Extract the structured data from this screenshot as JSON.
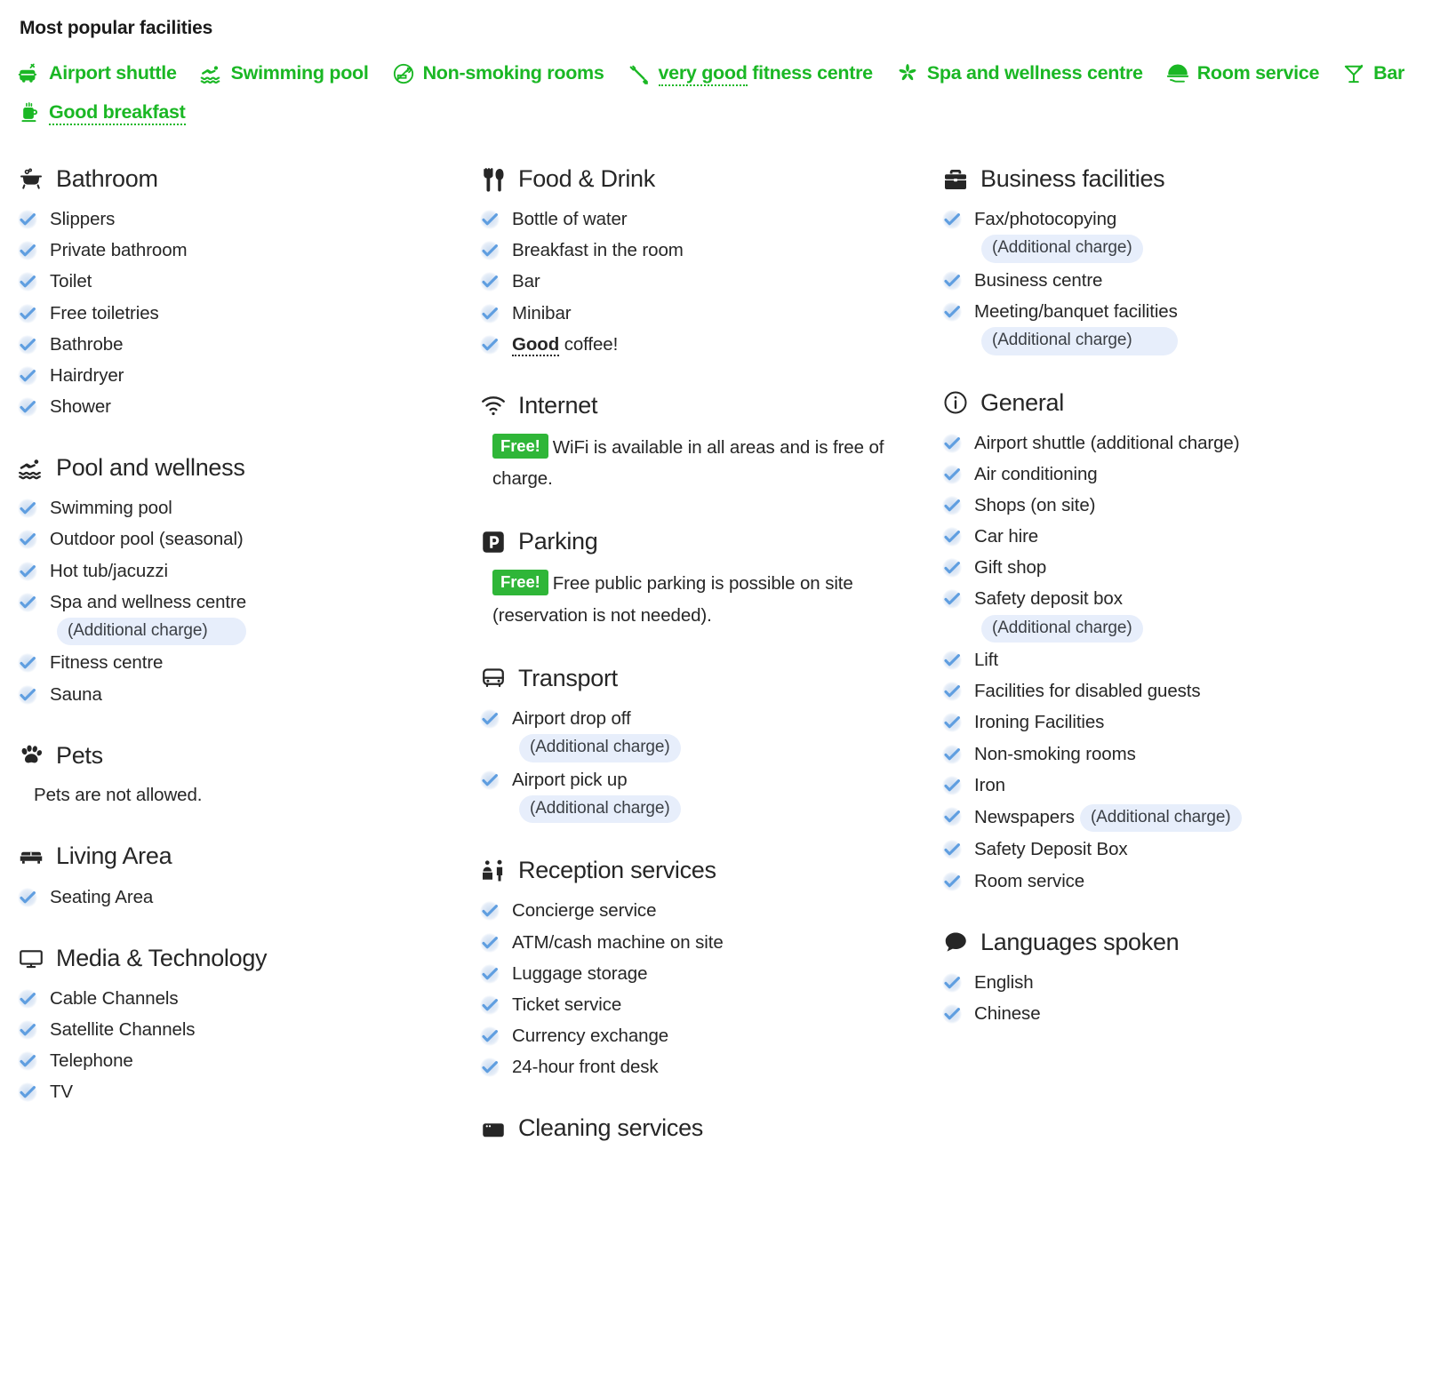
{
  "popular": {
    "title": "Most popular facilities",
    "items": [
      {
        "label": "Airport shuttle",
        "icon": "airport-shuttle-icon",
        "dotted": false
      },
      {
        "label": "Swimming pool",
        "icon": "swimming-pool-icon",
        "dotted": false
      },
      {
        "label": "Non-smoking rooms",
        "icon": "non-smoking-icon",
        "dotted": false
      },
      {
        "label": "very good fitness centre",
        "icon": "fitness-icon",
        "dotted": true,
        "dotted_part": "very good"
      },
      {
        "label": "Spa and wellness centre",
        "icon": "spa-icon",
        "dotted": false
      },
      {
        "label": "Room service",
        "icon": "room-service-icon",
        "dotted": false
      },
      {
        "label": "Bar",
        "icon": "bar-icon",
        "dotted": false
      },
      {
        "label": "Good breakfast",
        "icon": "breakfast-icon",
        "dotted": true,
        "dotted_part": "Good breakfast"
      }
    ]
  },
  "accent_green": "#1ab724",
  "free_badge_color": "#2fb638",
  "tick_color": "#5f9ee0",
  "charge_badge_bg": "#e7eefb",
  "columns": [
    {
      "groups": [
        {
          "title": "Bathroom",
          "icon": "bathtub-icon",
          "items": [
            {
              "label": "Slippers"
            },
            {
              "label": "Private bathroom"
            },
            {
              "label": "Toilet"
            },
            {
              "label": "Free toiletries"
            },
            {
              "label": "Bathrobe"
            },
            {
              "label": "Hairdryer"
            },
            {
              "label": "Shower"
            }
          ]
        },
        {
          "title": "Pool and wellness",
          "icon": "swimmer-icon",
          "items": [
            {
              "label": "Swimming pool"
            },
            {
              "label": "Outdoor pool (seasonal)"
            },
            {
              "label": "Hot tub/jacuzzi"
            },
            {
              "label": "Spa and wellness centre",
              "charge": "(Additional charge)",
              "charge_position": "block"
            },
            {
              "label": "Fitness centre"
            },
            {
              "label": "Sauna"
            }
          ]
        },
        {
          "title": "Pets",
          "icon": "paw-icon",
          "note": "Pets are not allowed.",
          "items": []
        },
        {
          "title": "Living Area",
          "icon": "sofa-icon",
          "items": [
            {
              "label": "Seating Area"
            }
          ]
        },
        {
          "title": "Media & Technology",
          "icon": "tv-icon",
          "items": [
            {
              "label": "Cable Channels"
            },
            {
              "label": "Satellite Channels"
            },
            {
              "label": "Telephone"
            },
            {
              "label": "TV"
            }
          ]
        }
      ]
    },
    {
      "groups": [
        {
          "title": "Food & Drink",
          "icon": "cutlery-icon",
          "items": [
            {
              "label": "Bottle of water"
            },
            {
              "label": "Breakfast in the room"
            },
            {
              "label": "Bar"
            },
            {
              "label": "Minibar"
            },
            {
              "label": "Good coffee!",
              "emphasis": "Good",
              "emphasis_rest": " coffee!"
            }
          ]
        },
        {
          "title": "Internet",
          "icon": "wifi-icon",
          "badge": "Free!",
          "paragraph": "WiFi is available in all areas and is free of charge.",
          "items": []
        },
        {
          "title": "Parking",
          "icon": "parking-icon",
          "badge": "Free!",
          "paragraph": "Free public parking is possible on site (reservation is not needed).",
          "items": []
        },
        {
          "title": "Transport",
          "icon": "bus-icon",
          "items": [
            {
              "label": "Airport drop off",
              "charge": "(Additional charge)",
              "charge_position": "block"
            },
            {
              "label": "Airport pick up",
              "charge": "(Additional charge)",
              "charge_position": "block"
            }
          ]
        },
        {
          "title": "Reception services",
          "icon": "reception-icon",
          "items": [
            {
              "label": "Concierge service"
            },
            {
              "label": "ATM/cash machine on site"
            },
            {
              "label": "Luggage storage"
            },
            {
              "label": "Ticket service"
            },
            {
              "label": "Currency exchange"
            },
            {
              "label": "24-hour front desk"
            }
          ]
        },
        {
          "title": "Cleaning services",
          "icon": "cleaning-icon",
          "cut_off": true,
          "items": []
        }
      ]
    },
    {
      "groups": [
        {
          "title": "Business facilities",
          "icon": "briefcase-icon",
          "items": [
            {
              "label": "Fax/photocopying",
              "charge": "(Additional charge)",
              "charge_position": "block"
            },
            {
              "label": "Business centre"
            },
            {
              "label": "Meeting/banquet facilities",
              "charge": "(Additional charge)",
              "charge_position": "block"
            }
          ]
        },
        {
          "title": "General",
          "icon": "info-icon",
          "items": [
            {
              "label": "Airport shuttle (additional charge)"
            },
            {
              "label": "Air conditioning"
            },
            {
              "label": "Shops (on site)"
            },
            {
              "label": "Car hire"
            },
            {
              "label": "Gift shop"
            },
            {
              "label": "Safety deposit box",
              "charge": "(Additional charge)",
              "charge_position": "block"
            },
            {
              "label": "Lift"
            },
            {
              "label": "Facilities for disabled guests"
            },
            {
              "label": "Ironing Facilities"
            },
            {
              "label": "Non-smoking rooms"
            },
            {
              "label": "Iron"
            },
            {
              "label": "Newspapers",
              "charge": "(Additional charge)",
              "charge_position": "inline"
            },
            {
              "label": "Safety Deposit Box"
            },
            {
              "label": "Room service"
            }
          ]
        },
        {
          "title": "Languages spoken",
          "icon": "speech-bubble-icon",
          "items": [
            {
              "label": "English"
            },
            {
              "label": "Chinese"
            }
          ]
        }
      ]
    }
  ]
}
